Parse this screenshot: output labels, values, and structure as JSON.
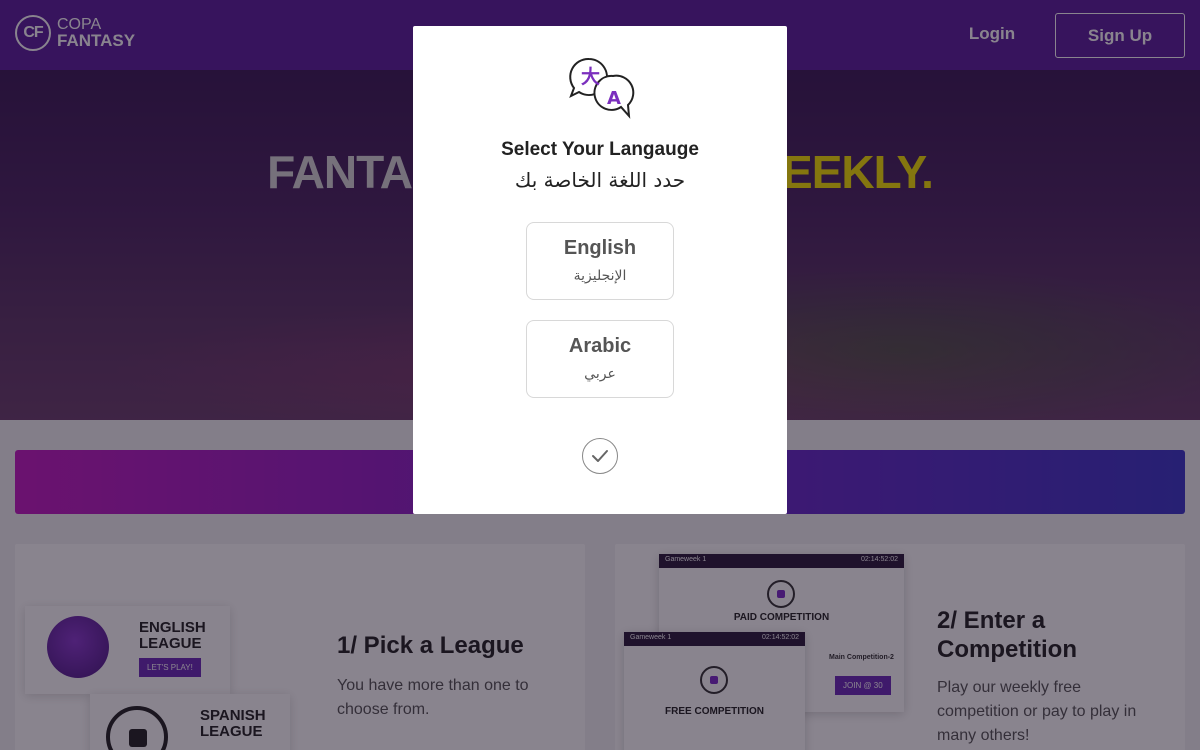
{
  "header": {
    "logo_mark": "CF",
    "logo_line1": "COPA",
    "logo_line2": "FANTASY",
    "login_label": "Login",
    "signup_label": "Sign Up"
  },
  "hero": {
    "title_left": "FANTA",
    "title_right": "EEKLY."
  },
  "cards": {
    "pick": {
      "title": "1/ Pick a League",
      "description": "You have more than one to choose from.",
      "leagues": [
        {
          "line1": "ENGLISH",
          "line2": "LEAGUE",
          "button": "LET'S PLAY!"
        },
        {
          "line1": "SPANISH",
          "line2": "LEAGUE"
        }
      ]
    },
    "enter": {
      "title_line1": "2/ Enter a",
      "title_line2": "Competition",
      "description": "Play our weekly free competition or pay to play in many others!",
      "panels": [
        {
          "gameweek": "Gameweek 1",
          "timer": "02:14:52:02",
          "title": "PAID COMPETITION"
        },
        {
          "gameweek": "Gameweek 1",
          "timer": "02:14:52:02",
          "title": "FREE COMPETITION"
        }
      ],
      "side_label": "Main Competition-2",
      "join_label": "JOIN @ 30"
    }
  },
  "modal": {
    "title": "Select Your Langauge",
    "subtitle": "حدد اللغة الخاصة بك",
    "options": [
      {
        "name": "English",
        "native": "الإنجليزية"
      },
      {
        "name": "Arabic",
        "native": "عربي"
      }
    ],
    "icon": "translate-icon",
    "confirm_icon": "check-circle-icon",
    "accent_color": "#7b2fbe"
  }
}
